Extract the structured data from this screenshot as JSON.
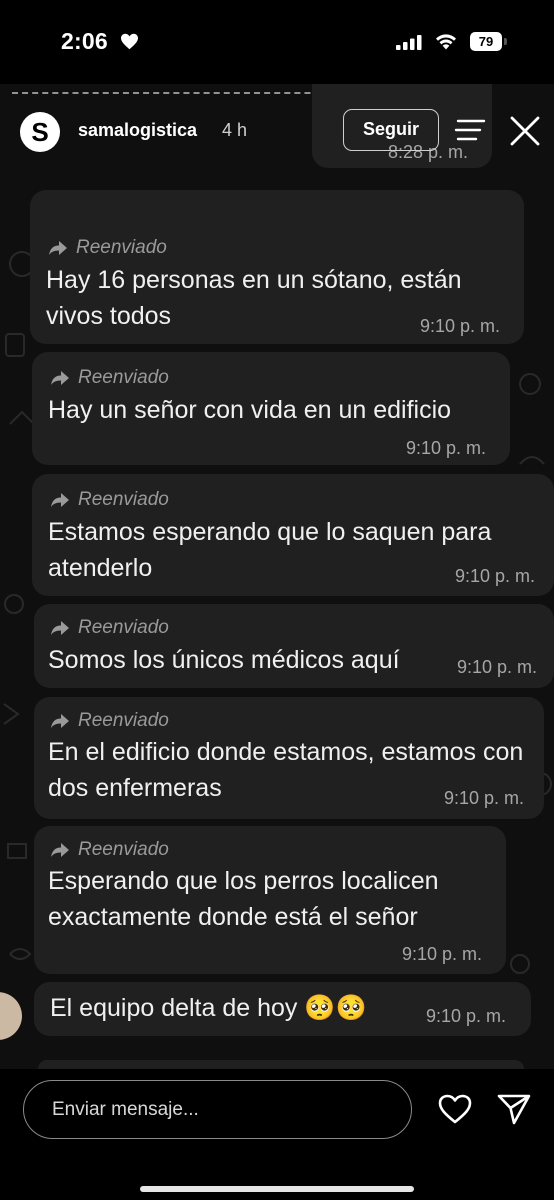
{
  "status_bar": {
    "time": "2:06",
    "battery": "79"
  },
  "story": {
    "username": "samalogistica",
    "time_ago": "4 h",
    "follow_label": "Seguir",
    "avatar_letter": "S"
  },
  "messages": [
    {
      "time": "8:28 p. m."
    },
    {
      "forwarded": "Reenviado",
      "text": "Hay 16 personas en un sótano, están vivos todos",
      "time": "9:10 p. m."
    },
    {
      "forwarded": "Reenviado",
      "text": "Hay un señor con vida en un edificio",
      "time": "9:10 p. m."
    },
    {
      "forwarded": "Reenviado",
      "text": "Estamos esperando que lo saquen para atenderlo",
      "time": "9:10 p. m."
    },
    {
      "forwarded": "Reenviado",
      "text": "Somos los únicos médicos aquí",
      "time": "9:10 p. m."
    },
    {
      "forwarded": "Reenviado",
      "text": "En el edificio donde estamos, estamos con dos enfermeras",
      "time": "9:10 p. m."
    },
    {
      "forwarded": "Reenviado",
      "text": "Esperando que los perros localicen exactamente donde está el señor",
      "time": "9:10 p. m."
    },
    {
      "text": "El equipo delta de hoy 🥺🥺",
      "time": "9:10 p. m."
    }
  ],
  "composer": {
    "placeholder": "Enviar mensaje..."
  },
  "icons": [
    "heart-icon",
    "cellular-signal-icon",
    "wifi-icon",
    "battery-icon",
    "forward-arrow-icon",
    "menu-icon",
    "close-icon",
    "like-icon",
    "send-icon"
  ]
}
